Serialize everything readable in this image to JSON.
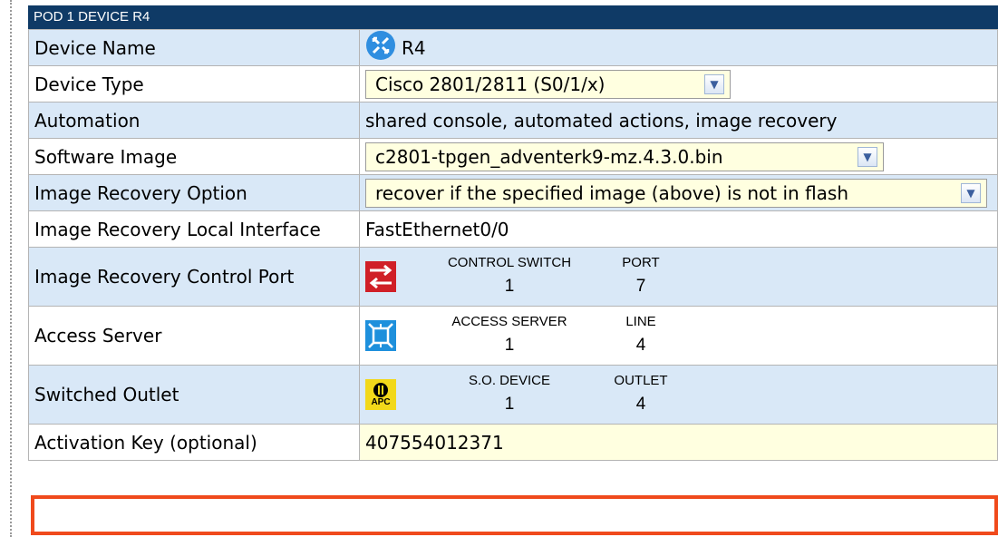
{
  "panel": {
    "title": "POD 1 DEVICE R4"
  },
  "rows": {
    "device_name": {
      "label": "Device Name",
      "value": "R4",
      "icon": "router-icon"
    },
    "device_type": {
      "label": "Device Type",
      "value": "Cisco 2801/2811 (S0/1/x)"
    },
    "automation": {
      "label": "Automation",
      "value": "shared console, automated actions, image recovery"
    },
    "software_image": {
      "label": "Software Image",
      "value": "c2801-tpgen_adventerk9-mz.4.3.0.bin"
    },
    "image_recovery_option": {
      "label": "Image Recovery Option",
      "value": "recover if the specified image (above) is not in flash"
    },
    "image_recovery_local_interface": {
      "label": "Image Recovery Local Interface",
      "value": "FastEthernet0/0"
    },
    "image_recovery_control_port": {
      "label": "Image Recovery Control Port",
      "icon": "control-switch-icon",
      "col1_header": "CONTROL SWITCH",
      "col1_value": "1",
      "col2_header": "PORT",
      "col2_value": "7"
    },
    "access_server": {
      "label": "Access Server",
      "icon": "access-server-icon",
      "col1_header": "ACCESS SERVER",
      "col1_value": "1",
      "col2_header": "LINE",
      "col2_value": "4"
    },
    "switched_outlet": {
      "label": "Switched Outlet",
      "icon": "apc-icon",
      "icon_text": "APC",
      "col1_header": "S.O. DEVICE",
      "col1_value": "1",
      "col2_header": "OUTLET",
      "col2_value": "4"
    },
    "activation_key": {
      "label": "Activation Key (optional)",
      "value": "407554012371"
    }
  },
  "colors": {
    "title_bar": "#0f3a66",
    "row_blue": "#d9e8f7",
    "input_yellow": "#ffffe0",
    "highlight": "#f04a1c"
  }
}
